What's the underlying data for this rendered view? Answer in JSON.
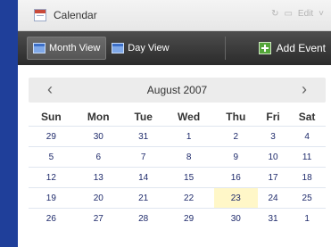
{
  "window": {
    "title": "Calendar",
    "controls": [
      "↻",
      "▭",
      "Edit",
      "˅"
    ]
  },
  "toolbar": {
    "month_view_label": "Month View",
    "day_view_label": "Day View",
    "add_event_label": "Add Event"
  },
  "calendar": {
    "month_label": "August 2007",
    "prev_symbol": "‹",
    "next_symbol": "›",
    "weekdays": [
      "Sun",
      "Mon",
      "Tue",
      "Wed",
      "Thu",
      "Fri",
      "Sat"
    ],
    "weeks": [
      [
        "29",
        "30",
        "31",
        "1",
        "2",
        "3",
        "4"
      ],
      [
        "5",
        "6",
        "7",
        "8",
        "9",
        "10",
        "11"
      ],
      [
        "12",
        "13",
        "14",
        "15",
        "16",
        "17",
        "18"
      ],
      [
        "19",
        "20",
        "21",
        "22",
        "23",
        "24",
        "25"
      ],
      [
        "26",
        "27",
        "28",
        "29",
        "30",
        "31",
        "1"
      ]
    ],
    "highlighted_day": "23",
    "highlight_color": "#fff7c8"
  },
  "colors": {
    "background": "#1f3f9a",
    "toolbar": "#2b2b2b",
    "accent_add": "#54a63a"
  }
}
